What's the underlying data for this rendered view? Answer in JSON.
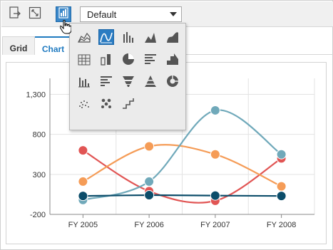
{
  "toolbar": {
    "buttons": [
      {
        "name": "export-icon"
      },
      {
        "name": "fullscreen-icon"
      },
      {
        "name": "chart-type-icon"
      }
    ],
    "series_dropdown": {
      "selected": "Default"
    }
  },
  "tabs": [
    {
      "label": "Grid",
      "active": false
    },
    {
      "label": "Chart",
      "active": true
    }
  ],
  "chart_types": [
    "stacked-area-icon",
    "spline-icon",
    "column-icon",
    "area-icon",
    "spline-area-icon",
    "stacked-column-icon",
    "stacked-column-100-icon",
    "pie-icon",
    "bar-icon",
    "step-area-icon",
    "stacked-column-alt-icon",
    "stacked-bar-icon",
    "funnel-icon",
    "pyramid-icon",
    "doughnut-icon",
    "scatter-icon",
    "bubble-icon",
    "step-line-icon"
  ],
  "selected_chart_type": "spline-icon",
  "colors": {
    "accent": "#1f7ac0",
    "series1": "#e15554",
    "series2": "#f59c57",
    "series3": "#70a9ba",
    "series4": "#0c4d6a"
  },
  "chart_data": {
    "type": "line",
    "categories": [
      "FY 2005",
      "FY 2006",
      "FY 2007",
      "FY 2008"
    ],
    "ylim": [
      -200,
      1500
    ],
    "yticks": [
      "-200",
      "300",
      "800",
      "1,300"
    ],
    "ytick_values": [
      -200,
      300,
      800,
      1300
    ],
    "grid": true,
    "series": [
      {
        "values": [
          600,
          90,
          -30,
          500
        ],
        "color": "#e15554"
      },
      {
        "values": [
          210,
          650,
          550,
          150
        ],
        "color": "#f59c57"
      },
      {
        "values": [
          -20,
          210,
          1100,
          550
        ],
        "color": "#70a9ba"
      },
      {
        "values": [
          30,
          40,
          35,
          30
        ],
        "color": "#0c4d6a"
      }
    ]
  }
}
